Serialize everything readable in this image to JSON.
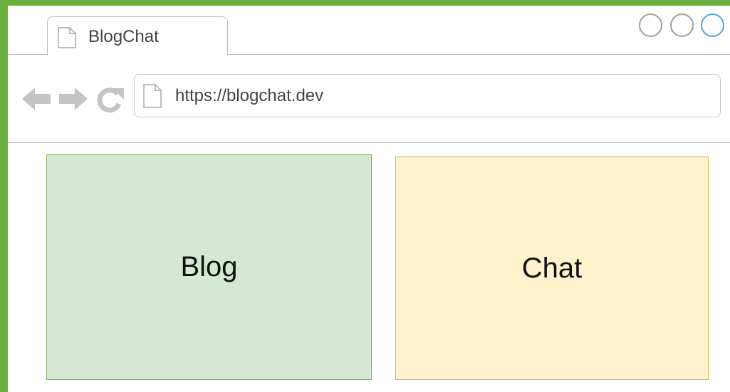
{
  "browser": {
    "tab_title": "BlogChat",
    "url": "https://blogchat.dev",
    "window_buttons": [
      "minimize",
      "maximize",
      "close"
    ]
  },
  "content": {
    "blog_label": "Blog",
    "chat_label": "Chat"
  },
  "colors": {
    "frame": "#6aaf3d",
    "blog_fill": "#d5e8d4",
    "blog_stroke": "#82b366",
    "chat_fill": "#fff2cc",
    "chat_stroke": "#d6b656",
    "nav_icon": "#c4c4c4",
    "active_window_button": "#5ba0dc"
  },
  "icons": {
    "tab": "document-icon",
    "back": "back-arrow-icon",
    "forward": "forward-arrow-icon",
    "reload": "reload-icon",
    "url": "document-icon"
  }
}
